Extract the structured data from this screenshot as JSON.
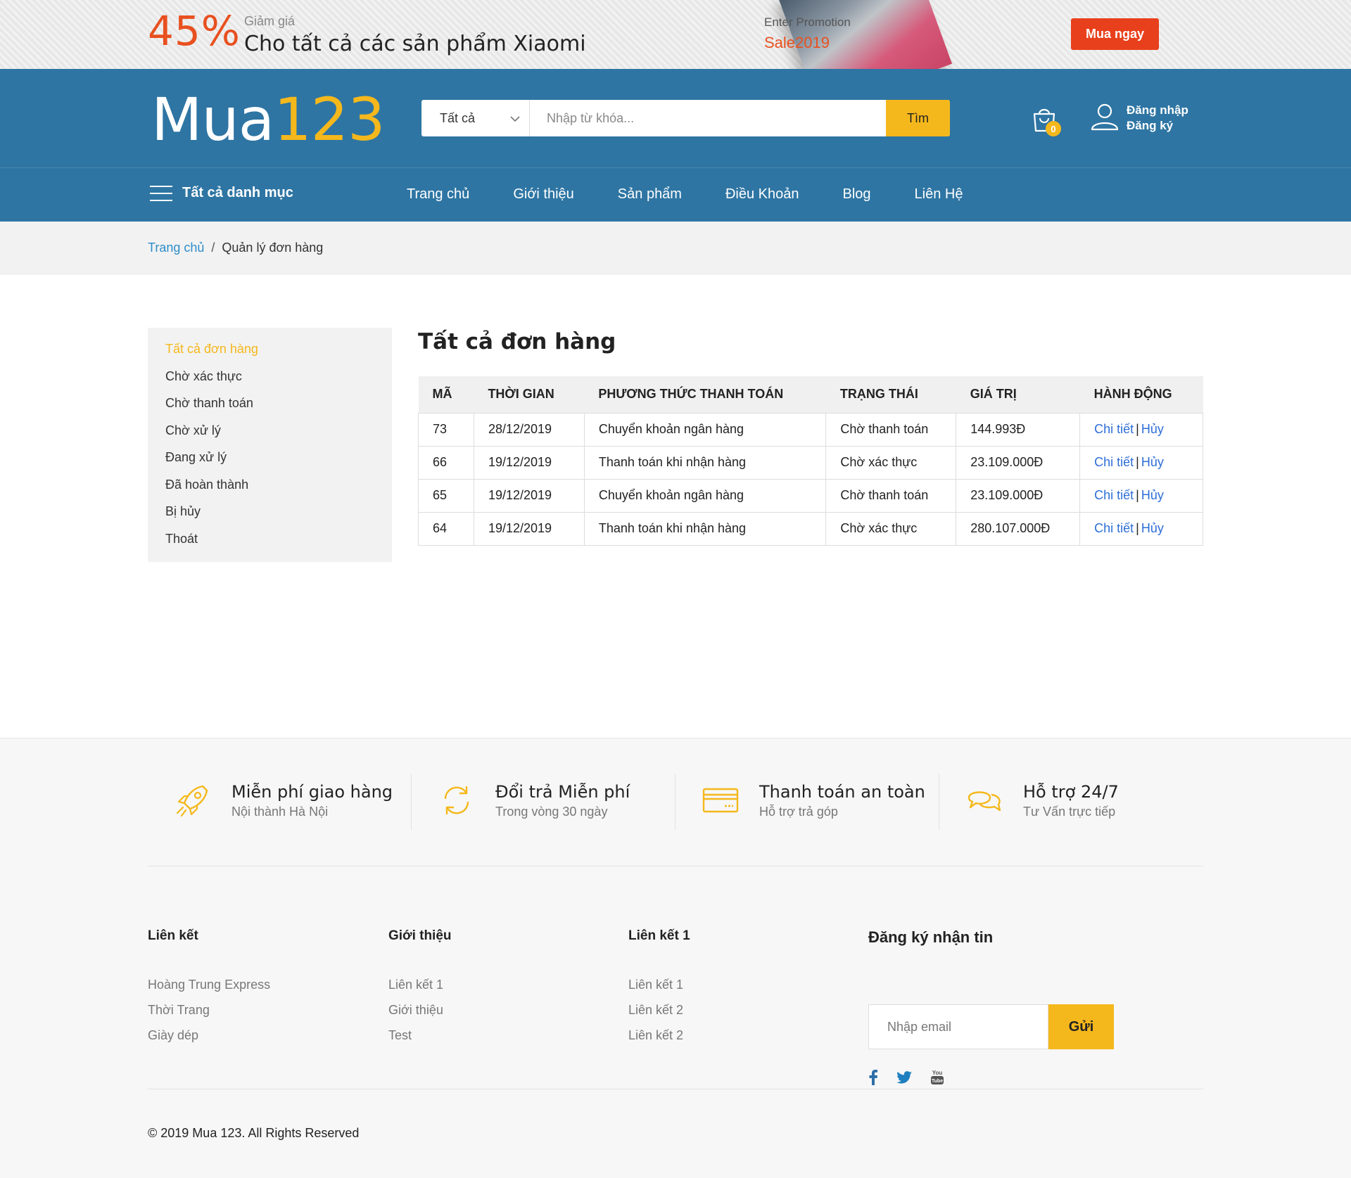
{
  "promo": {
    "percent": "45%",
    "label": "Giảm giá",
    "text": "Cho tất cả các sản phẩm Xiaomi",
    "image_line1": "Enter Promotion",
    "image_line2": "Sale2019",
    "button": "Mua ngay"
  },
  "header": {
    "logo_text": "Mua",
    "logo_num": "123",
    "search_category": "Tất cả",
    "search_placeholder": "Nhập từ khóa...",
    "search_button": "Tìm",
    "cart_count": "0",
    "login": "Đăng nhập",
    "register": "Đăng ký"
  },
  "nav": {
    "all_categories": "Tất cả danh mục",
    "items": [
      "Trang chủ",
      "Giới thiệu",
      "Sản phẩm",
      "Điều Khoản",
      "Blog",
      "Liên Hệ"
    ]
  },
  "breadcrumb": {
    "home": "Trang chủ",
    "separator": "/",
    "current": "Quản lý đơn hàng"
  },
  "sidebar": {
    "items": [
      "Tất cả đơn hàng",
      "Chờ xác thực",
      "Chờ thanh toán",
      "Chờ xử lý",
      "Đang xử lý",
      "Đã hoàn thành",
      "Bị hủy",
      "Thoát"
    ]
  },
  "orders": {
    "title": "Tất cả đơn hàng",
    "columns": [
      "MÃ",
      "THỜI GIAN",
      "PHƯƠNG THỨC THANH TOÁN",
      "TRẠNG THÁI",
      "GIÁ TRỊ",
      "HÀNH ĐỘNG"
    ],
    "rows": [
      {
        "id": "73",
        "time": "28/12/2019",
        "method": "Chuyển khoản ngân hàng",
        "status": "Chờ thanh toán",
        "value": "144.993Đ"
      },
      {
        "id": "66",
        "time": "19/12/2019",
        "method": "Thanh toán khi nhận hàng",
        "status": "Chờ xác thực",
        "value": "23.109.000Đ"
      },
      {
        "id": "65",
        "time": "19/12/2019",
        "method": "Chuyển khoản ngân hàng",
        "status": "Chờ thanh toán",
        "value": "23.109.000Đ"
      },
      {
        "id": "64",
        "time": "19/12/2019",
        "method": "Thanh toán khi nhận hàng",
        "status": "Chờ xác thực",
        "value": "280.107.000Đ"
      }
    ],
    "detail_label": "Chi tiết",
    "separator": "|",
    "cancel_label": "Hủy"
  },
  "features": [
    {
      "title": "Miễn phí giao hàng",
      "subtitle": "Nội thành Hà Nội",
      "icon": "rocket-icon"
    },
    {
      "title": "Đổi trả Miễn phí",
      "subtitle": "Trong vòng 30 ngày",
      "icon": "refresh-icon"
    },
    {
      "title": "Thanh toán an toàn",
      "subtitle": "Hỗ trợ trả góp",
      "icon": "credit-card-icon"
    },
    {
      "title": "Hỗ trợ 24/7",
      "subtitle": "Tư Vấn trực tiếp",
      "icon": "chat-icon"
    }
  ],
  "footer": {
    "columns": [
      {
        "title": "Liên kết",
        "links": [
          "Hoàng Trung Express",
          "Thời Trang",
          "Giày dép"
        ]
      },
      {
        "title": "Giới thiệu",
        "links": [
          "Liên kết 1",
          "Giới thiệu",
          "Test"
        ]
      },
      {
        "title": "Liên kết 1",
        "links": [
          "Liên kết 1",
          "Liên kết 2",
          "Liên kết 2"
        ]
      }
    ],
    "newsletter_title": "Đăng ký nhận tin",
    "email_placeholder": "Nhập email",
    "send_button": "Gửi",
    "social": [
      "facebook-icon",
      "twitter-icon",
      "youtube-icon"
    ],
    "copyright": "© 2019 Mua 123. All Rights Reserved"
  },
  "colors": {
    "primary": "#2e75a3",
    "accent": "#f5b81c",
    "promo": "#e8501f",
    "link": "#2e6ed6"
  }
}
